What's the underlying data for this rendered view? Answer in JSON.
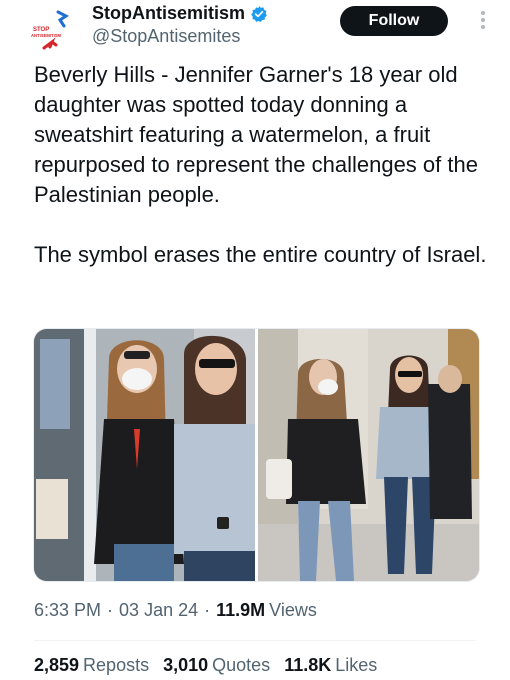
{
  "author": {
    "display_name": "StopAntisemitism",
    "handle": "@StopAntisemites",
    "avatar_text": [
      "STOP",
      "ANTISEMITISM"
    ],
    "verified": true,
    "follow_label": "Follow"
  },
  "tweet": {
    "paragraphs": [
      "Beverly Hills - Jennifer Garner's 18 year old daughter was spotted today donning a sweatshirt featuring a watermelon, a fruit repurposed to represent the challenges of the Palestinian people.",
      "The symbol erases the entire country of Israel."
    ]
  },
  "meta": {
    "time": "6:33 PM",
    "date": "03 Jan 24",
    "views_count": "11.9M",
    "views_label": "Views"
  },
  "stats": [
    {
      "count": "2,859",
      "label": "Reposts"
    },
    {
      "count": "3,010",
      "label": "Quotes"
    },
    {
      "count": "11.8K",
      "label": "Likes"
    }
  ],
  "colors": {
    "text": "#0f1419",
    "secondary": "#536471",
    "verified": "#1d9bf0",
    "follow_bg": "#0f1419"
  },
  "icons": [
    "logo-icon",
    "verified-badge-icon",
    "more-icon"
  ]
}
